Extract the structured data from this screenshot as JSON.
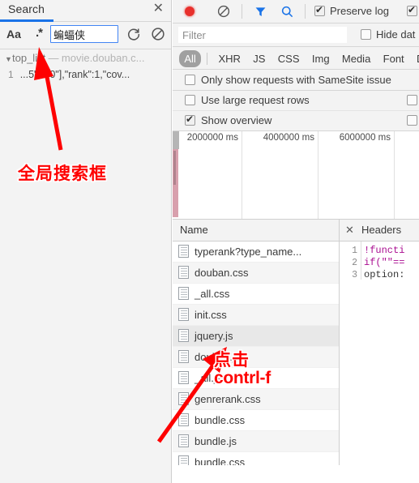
{
  "search_panel": {
    "tab_label": "Search",
    "close_icon": "close-icon",
    "toolbar": {
      "match_case_label": "Aa",
      "regex_label": ".*",
      "input_value": "蝙蝠侠",
      "refresh_icon": "refresh-icon",
      "clear_icon": "clear-icon"
    },
    "results": {
      "group_triangle": "▼",
      "group_name": "top_list",
      "group_dash": "—",
      "group_url": "movie.douban.c...",
      "line_number": "1",
      "line_text": "...5\",\"50\"],\"rank\":1,\"cov..."
    }
  },
  "network_panel": {
    "toolbar": {
      "record_icon": "record-icon",
      "clear_icon": "clear-requests-icon",
      "filter_icon": "filter-icon",
      "search_icon": "search-icon",
      "preserve_log_label": "Preserve log",
      "preserve_log_checked": true,
      "disable_cache_checked": true
    },
    "filter": {
      "placeholder": "Filter",
      "value": "",
      "hide_data_urls_label": "Hide dat",
      "hide_data_urls_checked": false
    },
    "type_filters": [
      {
        "label": "All",
        "active": true
      },
      {
        "label": "XHR",
        "active": false
      },
      {
        "label": "JS",
        "active": false
      },
      {
        "label": "CSS",
        "active": false
      },
      {
        "label": "Img",
        "active": false
      },
      {
        "label": "Media",
        "active": false
      },
      {
        "label": "Font",
        "active": false
      },
      {
        "label": "D",
        "active": false
      }
    ],
    "samesite_label": "Only show requests with SameSite issue",
    "samesite_checked": false,
    "large_rows_label": "Use large request rows",
    "large_rows_checked": false,
    "show_overview_label": "Show overview",
    "show_overview_checked": true,
    "overview": {
      "ticks": [
        "2000000 ms",
        "4000000 ms",
        "6000000 ms"
      ]
    },
    "requests": {
      "column_header": "Name",
      "rows": [
        {
          "name": "typerank?type_name...",
          "selected": false
        },
        {
          "name": "douban.css",
          "selected": false
        },
        {
          "name": "_all.css",
          "selected": false
        },
        {
          "name": "init.css",
          "selected": false
        },
        {
          "name": "jquery.js",
          "selected": true
        },
        {
          "name": "douban.js",
          "selected": false
        },
        {
          "name": "_all.js",
          "selected": false
        },
        {
          "name": "genrerank.css",
          "selected": false
        },
        {
          "name": "bundle.css",
          "selected": false
        },
        {
          "name": "bundle.js",
          "selected": false
        },
        {
          "name": "bundle.css",
          "selected": false
        }
      ]
    },
    "details": {
      "close_icon": "close-icon",
      "tab_label": "Headers",
      "code_lines": [
        {
          "no": "1",
          "text": "!functi"
        },
        {
          "no": "2",
          "text": "if(\"\"=="
        },
        {
          "no": "3",
          "text": "option:"
        }
      ]
    }
  },
  "annotations": {
    "global_search_box": "全局搜索框",
    "click": "点击",
    "ctrl_f": "contrl-f",
    "color": "#fe0000"
  }
}
